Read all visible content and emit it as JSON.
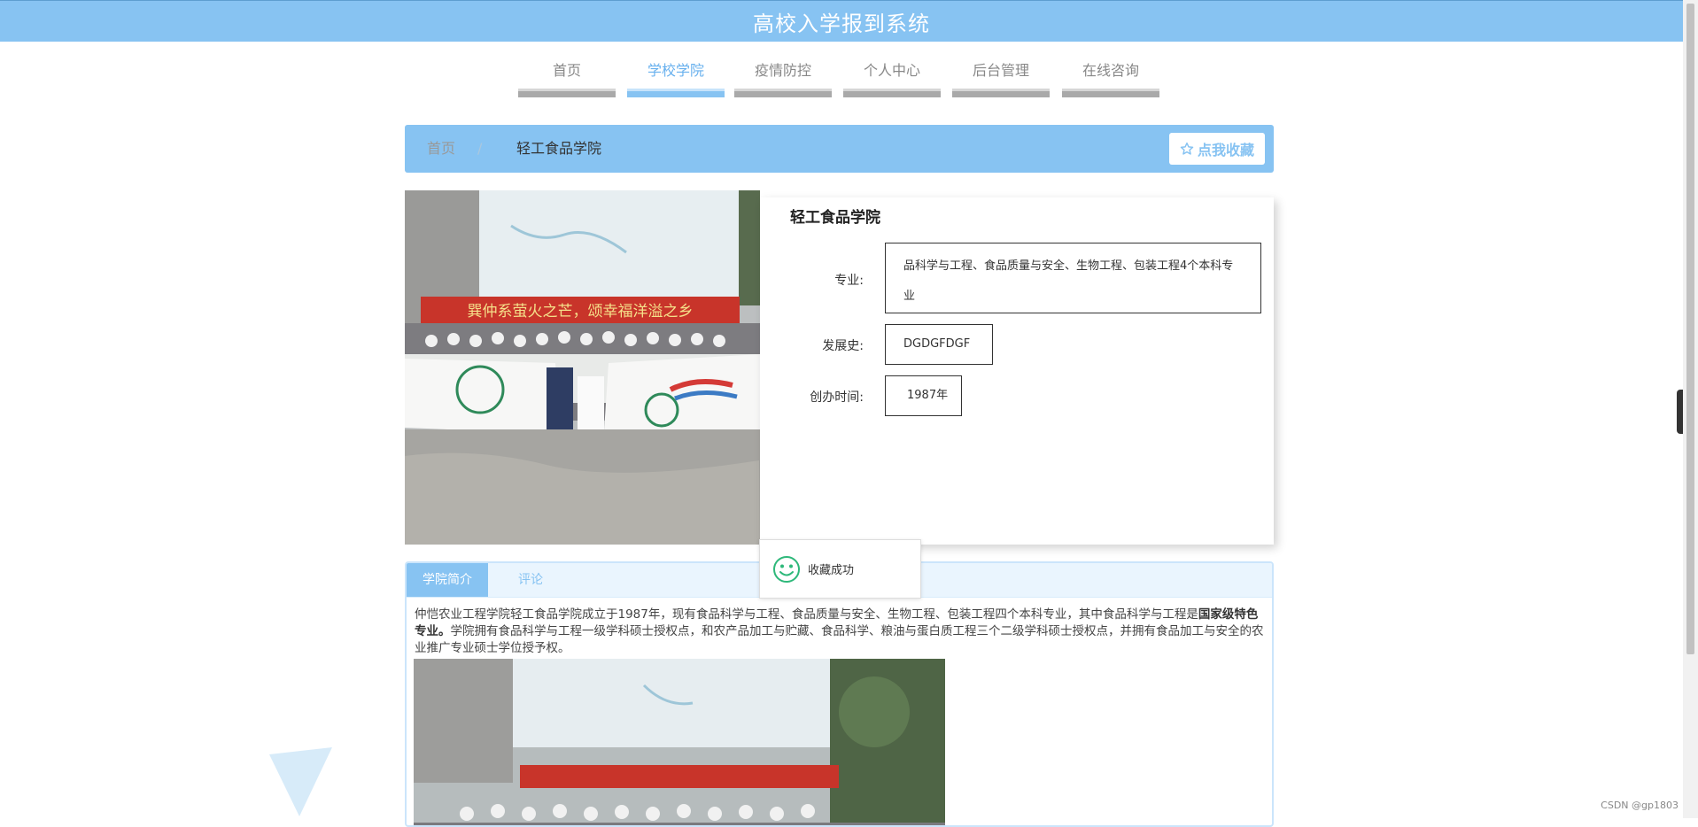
{
  "header": {
    "title": "高校入学报到系统"
  },
  "nav": {
    "items": [
      {
        "label": "首页"
      },
      {
        "label": "学校学院"
      },
      {
        "label": "疫情防控"
      },
      {
        "label": "个人中心"
      },
      {
        "label": "后台管理"
      },
      {
        "label": "在线咨询"
      }
    ],
    "active_index": 1
  },
  "breadcrumb": {
    "home": "首页",
    "separator": "/",
    "current": "轻工食品学院",
    "favorite_label": "点我收藏",
    "favorite_icon": "star-outline-icon"
  },
  "detail": {
    "title": "轻工食品学院",
    "major_label": "专业:",
    "major_value": "品科学与工程、食品质量与安全、生物工程、包装工程4个本科专业",
    "history_label": "发展史:",
    "history_value": "DGDGFDGF",
    "founded_label": "创办时间:",
    "founded_value": "1987年"
  },
  "hero_banner_text": "巽仲系萤火之芒，颂幸福洋溢之乡",
  "toast": {
    "message": "收藏成功",
    "icon": "smile-icon"
  },
  "tabs": [
    {
      "label": "学院简介"
    },
    {
      "label": "评论"
    }
  ],
  "intro": {
    "part1": "仲恺农业工程学院轻工食品学院成立于1987年，现有食品科学与工程、食品质量与安全、生物工程、包装工程四个本科专业，其中食品科学与工程是",
    "bold": "国家级特色专业。",
    "part2": "学院拥有食品科学与工程一级学科硕士授权点，和农产品加工与贮藏、食品科学、粮油与蛋白质工程三个二级学科硕士授权点，并拥有食品加工与安全的农业推广专业硕士学位授予权。"
  },
  "watermark": "CSDN @gp1803",
  "colors": {
    "accent": "#87c3f2",
    "accent_text": "#67b0ee",
    "toast_icon": "#2eb87a"
  }
}
